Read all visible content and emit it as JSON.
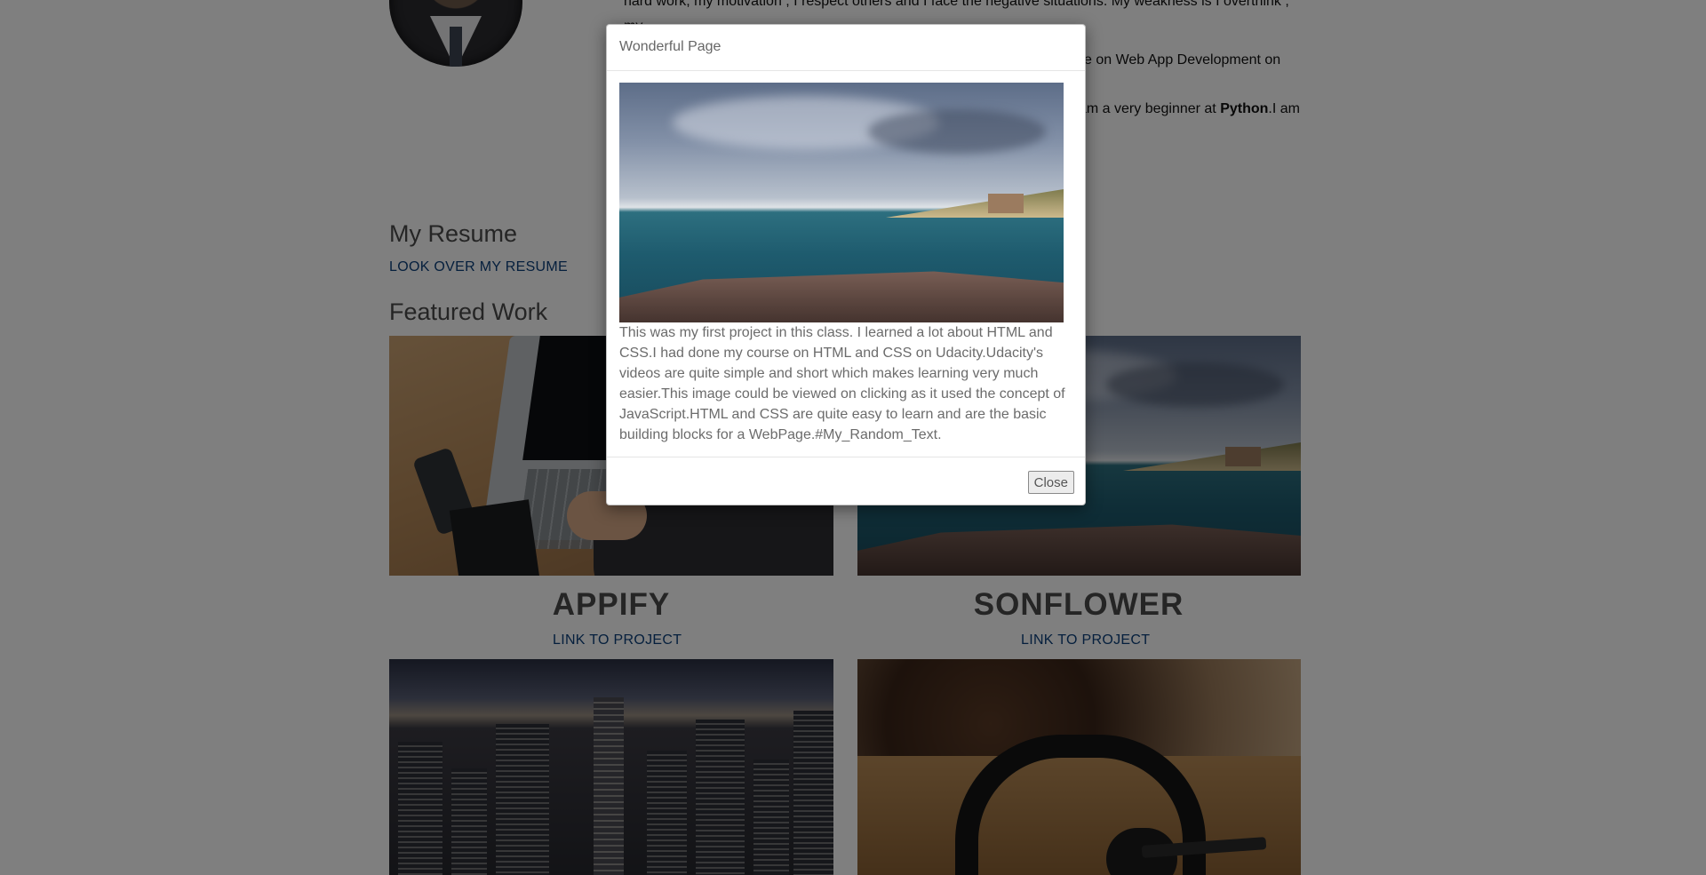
{
  "about": {
    "line1": "hard work, my motivation , I respect others and I face the negative situations. My weakness is I overthink , my",
    "right_fragment_course": "se on Web App Development on",
    "right_fragment_python_pre": "am a very beginner at ",
    "right_fragment_python_bold": "Python",
    "right_fragment_python_post": ".I am"
  },
  "resume": {
    "heading": "My Resume",
    "link": "LOOK OVER MY RESUME"
  },
  "featured": {
    "heading": "Featured Work",
    "projects": [
      {
        "title": "APPIFY",
        "link": "LINK TO PROJECT"
      },
      {
        "title": "SONFLOWER",
        "link": "LINK TO PROJECT"
      }
    ]
  },
  "modal": {
    "title": "Wonderful Page",
    "text": "This was my first project in this class. I learned a lot about HTML and CSS.I had done my course on HTML and CSS on Udacity.Udacity's videos are quite simple and short which makes learning very much easier.This image could be viewed on clicking as it used the concept of JavaScript.HTML and CSS are quite easy to learn and are the basic building blocks for a WebPage.#My_Random_Text.",
    "close_label": "Close"
  },
  "colors": {
    "link": "#0b3e7a",
    "overlay": "rgba(0,0,0,0.5)",
    "heading": "#4a4a4a"
  },
  "icons": {
    "avatar": "profile-photo"
  }
}
